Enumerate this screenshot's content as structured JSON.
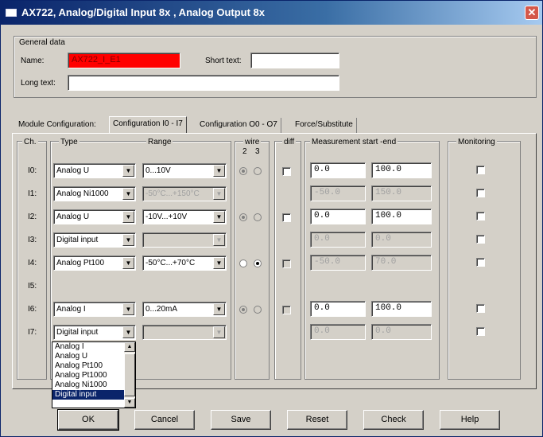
{
  "window": {
    "title": "AX722, Analog/Digital Input 8x , Analog Output 8x",
    "close": "✕"
  },
  "general": {
    "group_title": "General data",
    "name_label": "Name:",
    "name_value": "AX722_I_E1",
    "short_text_label": "Short text:",
    "short_text_value": "",
    "long_text_label": "Long text:",
    "long_text_value": ""
  },
  "tabs": {
    "static_label": "Module Configuration:",
    "items": [
      "Configuration I0 - I7",
      "Configuration O0 - O7",
      "Force/Substitute"
    ]
  },
  "headers": {
    "ch": "Ch.",
    "type": "Type",
    "range": "Range",
    "wire": "wire",
    "wire_2": "2",
    "wire_3": "3",
    "diff": "diff",
    "measurement": "Measurement start  -end",
    "monitoring": "Monitoring"
  },
  "rows": [
    {
      "ch": "I0:",
      "type": "Analog U",
      "range": "0...10V",
      "start": "0.0",
      "end": "100.0"
    },
    {
      "ch": "I1:",
      "type": "Analog Ni1000",
      "range": "-50°C...+150°C",
      "start": "-50.0",
      "end": "150.0"
    },
    {
      "ch": "I2:",
      "type": "Analog U",
      "range": "-10V...+10V",
      "start": "0.0",
      "end": "100.0"
    },
    {
      "ch": "I3:",
      "type": "Digital input",
      "range": "",
      "start": "0.0",
      "end": "0.0"
    },
    {
      "ch": "I4:",
      "type": "Analog Pt100",
      "range": "-50°C...+70°C",
      "start": "-50.0",
      "end": "70.0"
    },
    {
      "ch": "I5:"
    },
    {
      "ch": "I6:",
      "type": "Analog I",
      "range": "0...20mA",
      "start": "0.0",
      "end": "100.0"
    },
    {
      "ch": "I7:",
      "type": "Digital input",
      "range": "",
      "start": "0.0",
      "end": "0.0"
    }
  ],
  "dropdown": {
    "options": [
      "Analog I",
      "Analog U",
      "Analog Pt100",
      "Analog Pt1000",
      "Analog Ni1000",
      "Digital input"
    ],
    "selected_index": 5
  },
  "buttons": {
    "ok": "OK",
    "cancel": "Cancel",
    "save": "Save",
    "reset": "Reset",
    "check": "Check",
    "help": "Help"
  },
  "icons": {
    "dropdown_arrow": "▼",
    "scroll_up": "▲",
    "scroll_down": "▼"
  },
  "colors": {
    "name_field": "#ff0000",
    "title_bar": "#0a246a",
    "selection": "#0a246a"
  }
}
